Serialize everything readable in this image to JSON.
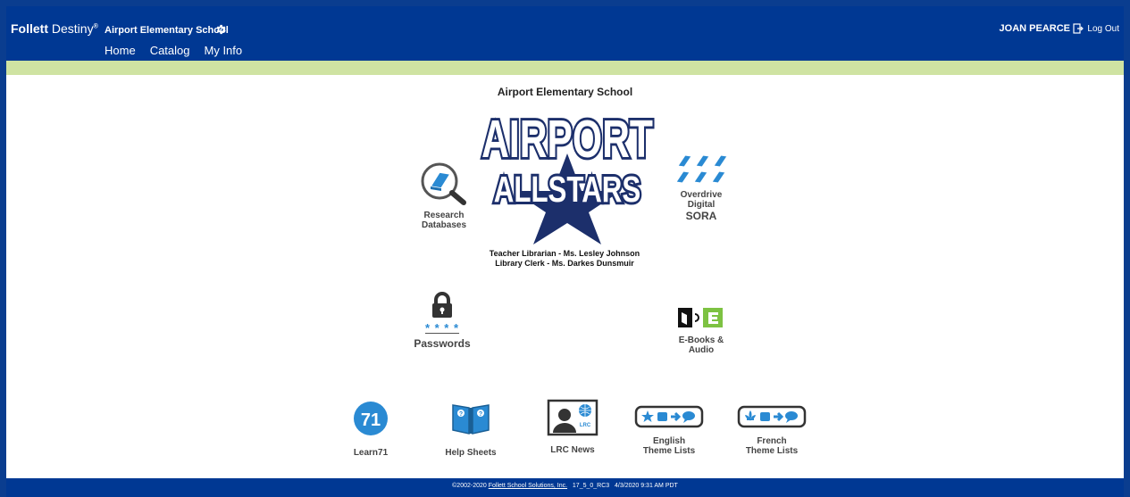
{
  "header": {
    "brand_bold": "Follett",
    "brand_light": "Destiny",
    "brand_mark": "®",
    "school_name": "Airport Elementary School",
    "user_name": "JOAN PEARCE",
    "logout_label": "Log Out",
    "tabs": [
      {
        "label": "Home",
        "active": true
      },
      {
        "label": "Catalog",
        "active": false
      },
      {
        "label": "My Info",
        "active": false
      }
    ]
  },
  "main": {
    "title": "Airport Elementary School",
    "logo_line1": "AIRPORT",
    "logo_line2": "ALLSTARS",
    "staff_line1": "Teacher Librarian - Ms. Lesley Johnson",
    "staff_line2": "Library Clerk - Ms. Darkes Dunsmuir",
    "links": {
      "research": {
        "line1": "Research",
        "line2": "Databases"
      },
      "overdrive": {
        "line1": "Overdrive",
        "line2": "Digital",
        "line3": "SORA"
      },
      "passwords": {
        "label": "Passwords",
        "stars": "* * * *"
      },
      "ebooks": {
        "line1": "E-Books &",
        "line2": "Audio"
      },
      "learn71": {
        "label": "Learn71",
        "badge": "71"
      },
      "helpsheets": {
        "label": "Help Sheets"
      },
      "lrcnews": {
        "label": "LRC News",
        "badge": "LRC"
      },
      "english": {
        "line1": "English",
        "line2": "Theme Lists"
      },
      "french": {
        "line1": "French",
        "line2": "Theme Lists"
      }
    }
  },
  "footer": {
    "copyright": "©2002-2020",
    "company_link": "Follett School Solutions, Inc.",
    "version": "17_5_0_RC3",
    "timestamp": "4/3/2020 9:31 AM PDT"
  },
  "colors": {
    "header_bg": "#003893",
    "accent_green": "#cfe3a2",
    "tab_underline": "#e58a2f",
    "icon_blue": "#2a8ad3",
    "logo_navy": "#1c2f6b",
    "ebook_green": "#7dc242"
  }
}
